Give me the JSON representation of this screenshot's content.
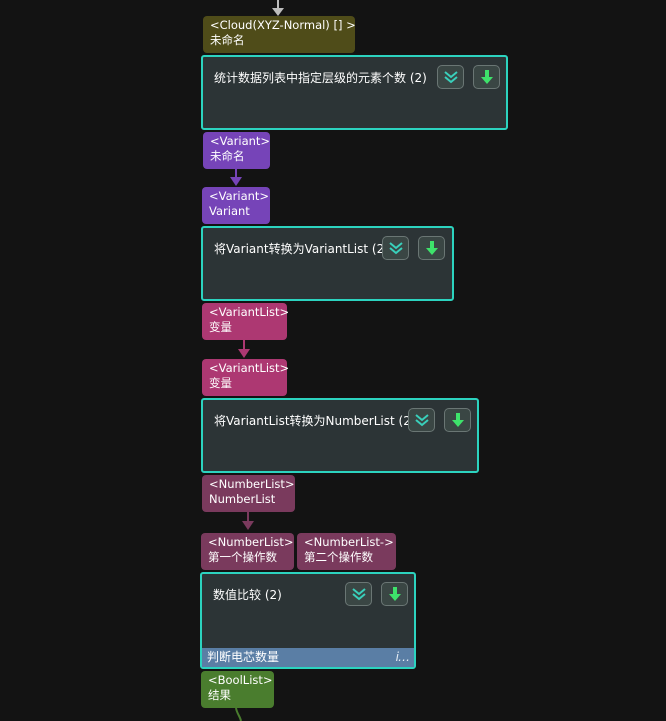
{
  "nodes": {
    "count_elements": {
      "title": "统计数据列表中指定层级的元素个数 (2)"
    },
    "variant_to_list": {
      "title": "将Variant转换为VariantList (2)"
    },
    "vlist_to_nlist": {
      "title": "将VariantList转换为NumberList (2)"
    },
    "compare": {
      "title": "数值比较 (2)",
      "footer": "判断电芯数量"
    }
  },
  "ports": {
    "cloud_in": {
      "type": "<Cloud(XYZ-Normal) [] >",
      "name": "未命名"
    },
    "variant_out": {
      "type": "<Variant>",
      "name": "未命名"
    },
    "variant_in": {
      "type": "<Variant>",
      "name": "Variant"
    },
    "vlist_out": {
      "type": "<VariantList>",
      "name": "变量"
    },
    "vlist_in": {
      "type": "<VariantList>",
      "name": "变量"
    },
    "nlist_out": {
      "type": "<NumberList>",
      "name": "NumberList"
    },
    "nlist_in1": {
      "type": "<NumberList>",
      "name": "第一个操作数"
    },
    "nlist_in2": {
      "type": "<NumberList->",
      "name": "第二个操作数"
    },
    "bool_out": {
      "type": "<BoolList>",
      "name": "结果"
    }
  },
  "icons": {
    "collapse": "chevron-double-down-icon",
    "download": "arrow-down-icon",
    "info": "info-icon"
  },
  "colors": {
    "node_border": "#2cd3bf",
    "node_body": "#2c3436",
    "cloud_port": "#4f4c19",
    "variant_port": "#7644b8",
    "variant_list_port": "#ad3872",
    "number_list_port": "#7a3a5d",
    "bool_port": "#4a7d2e",
    "footer": "#5a7ea5"
  }
}
